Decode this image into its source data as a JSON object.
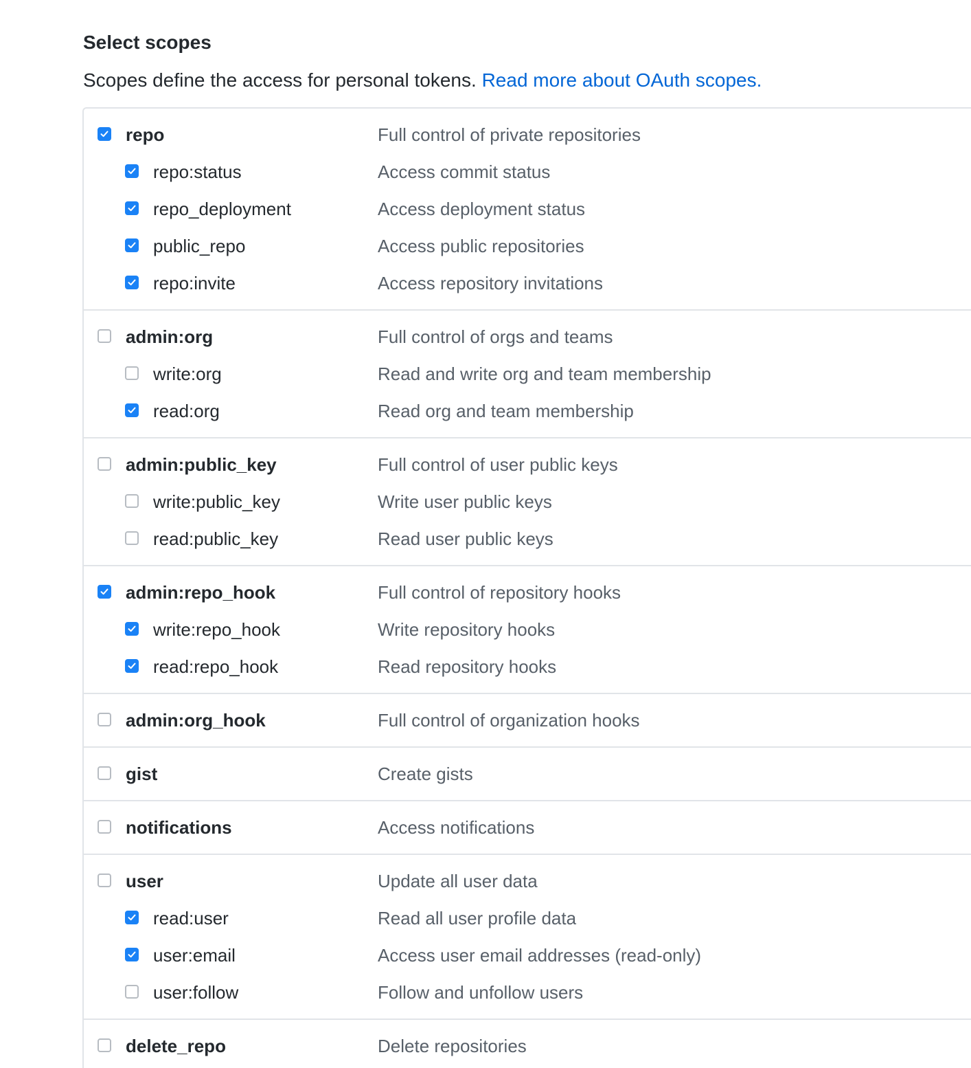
{
  "header": {
    "title": "Select scopes",
    "lead_text": "Scopes define the access for personal tokens.",
    "lead_link": "Read more about OAuth scopes."
  },
  "colors": {
    "checkbox_checked": "#1a82f6",
    "link": "#0366d6",
    "description": "#586069",
    "border": "#e1e4e8"
  },
  "icons": {
    "checked": "checkmark-icon"
  },
  "groups": [
    {
      "name": "repo",
      "desc": "Full control of private repositories",
      "checked": true,
      "children": [
        {
          "name": "repo:status",
          "desc": "Access commit status",
          "checked": true
        },
        {
          "name": "repo_deployment",
          "desc": "Access deployment status",
          "checked": true
        },
        {
          "name": "public_repo",
          "desc": "Access public repositories",
          "checked": true
        },
        {
          "name": "repo:invite",
          "desc": "Access repository invitations",
          "checked": true
        }
      ]
    },
    {
      "name": "admin:org",
      "desc": "Full control of orgs and teams",
      "checked": false,
      "children": [
        {
          "name": "write:org",
          "desc": "Read and write org and team membership",
          "checked": false
        },
        {
          "name": "read:org",
          "desc": "Read org and team membership",
          "checked": true
        }
      ]
    },
    {
      "name": "admin:public_key",
      "desc": "Full control of user public keys",
      "checked": false,
      "children": [
        {
          "name": "write:public_key",
          "desc": "Write user public keys",
          "checked": false
        },
        {
          "name": "read:public_key",
          "desc": "Read user public keys",
          "checked": false
        }
      ]
    },
    {
      "name": "admin:repo_hook",
      "desc": "Full control of repository hooks",
      "checked": true,
      "children": [
        {
          "name": "write:repo_hook",
          "desc": "Write repository hooks",
          "checked": true
        },
        {
          "name": "read:repo_hook",
          "desc": "Read repository hooks",
          "checked": true
        }
      ]
    },
    {
      "name": "admin:org_hook",
      "desc": "Full control of organization hooks",
      "checked": false,
      "children": []
    },
    {
      "name": "gist",
      "desc": "Create gists",
      "checked": false,
      "children": []
    },
    {
      "name": "notifications",
      "desc": "Access notifications",
      "checked": false,
      "children": []
    },
    {
      "name": "user",
      "desc": "Update all user data",
      "checked": false,
      "children": [
        {
          "name": "read:user",
          "desc": "Read all user profile data",
          "checked": true
        },
        {
          "name": "user:email",
          "desc": "Access user email addresses (read-only)",
          "checked": true
        },
        {
          "name": "user:follow",
          "desc": "Follow and unfollow users",
          "checked": false
        }
      ]
    },
    {
      "name": "delete_repo",
      "desc": "Delete repositories",
      "checked": false,
      "children": []
    }
  ]
}
